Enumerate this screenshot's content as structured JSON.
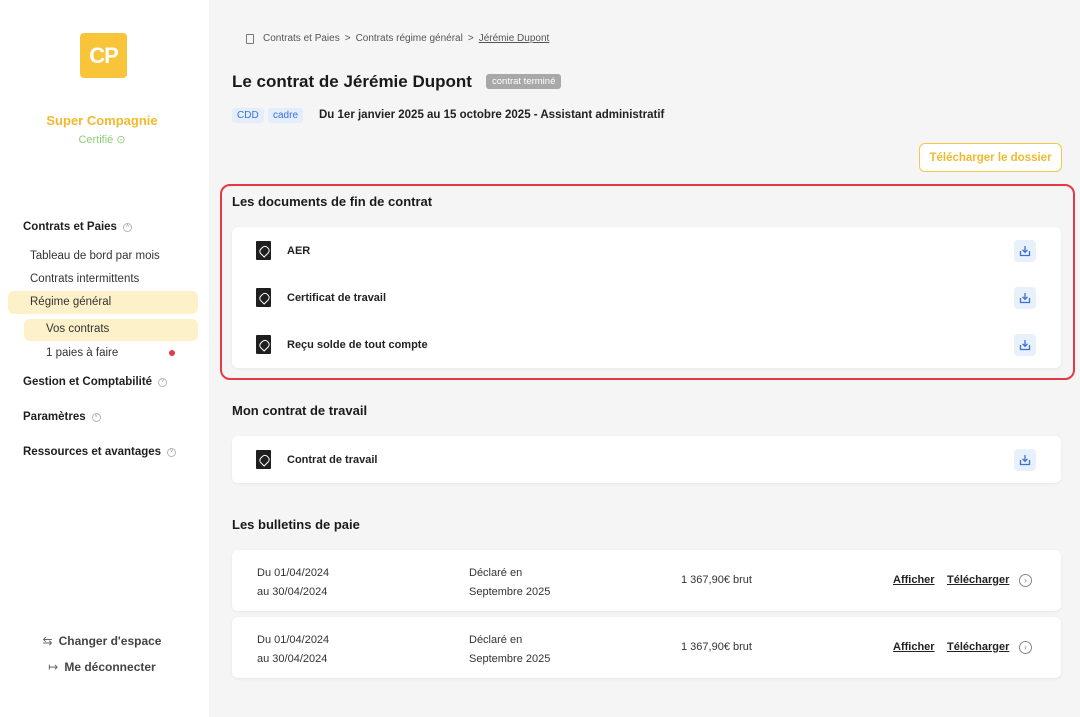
{
  "sidebar": {
    "logo_text": "CP",
    "company_name": "Super Compagnie",
    "certified_label": "Certifié",
    "sections": {
      "contrats": "Contrats et Paies",
      "gestion": "Gestion et Comptabilité",
      "parametres": "Paramètres",
      "ressources": "Ressources et avantages"
    },
    "items": {
      "tableau": "Tableau de bord par mois",
      "intermittents": "Contrats intermittents",
      "regime": "Régime général",
      "vos_contrats": "Vos contrats",
      "paies": "1 paies à faire"
    },
    "changer_espace": "Changer d'espace",
    "deconnecter": "Me déconnecter"
  },
  "breadcrumb": {
    "first": "Contrats et Paies",
    "second": "Contrats régime général",
    "current": "Jérémie Dupont",
    "separator": ">"
  },
  "header": {
    "title": "Le contrat de Jérémie Dupont",
    "status": "contrat terminé",
    "tags": [
      "CDD",
      "cadre"
    ],
    "subtitle": "Du 1er janvier 2025 au 15 octobre 2025 - Assistant administratif",
    "download_folder": "Télécharger le dossier"
  },
  "fin_contrat": {
    "title": "Les documents de fin de contrat",
    "docs": [
      "AER",
      "Certificat de travail",
      "Reçu solde de tout compte"
    ]
  },
  "mon_contrat": {
    "title": "Mon contrat de travail",
    "docs": [
      "Contrat de travail"
    ]
  },
  "bulletins": {
    "title": "Les bulletins de paie",
    "rows": [
      {
        "from": "Du 01/04/2024",
        "to": "au 30/04/2024",
        "decl1": "Déclaré en",
        "decl2": "Septembre 2025",
        "amount": "1 367,90€ brut",
        "view": "Afficher",
        "download": "Télécharger"
      },
      {
        "from": "Du 01/04/2024",
        "to": "au 30/04/2024",
        "decl1": "Déclaré en",
        "decl2": "Septembre 2025",
        "amount": "1 367,90€ brut",
        "view": "Afficher",
        "download": "Télécharger"
      }
    ]
  },
  "colors": {
    "accent_yellow": "#f8c43a",
    "highlight_red": "#e53945",
    "tag_blue": "#3b72d8",
    "certified_green": "#8fcf78"
  }
}
